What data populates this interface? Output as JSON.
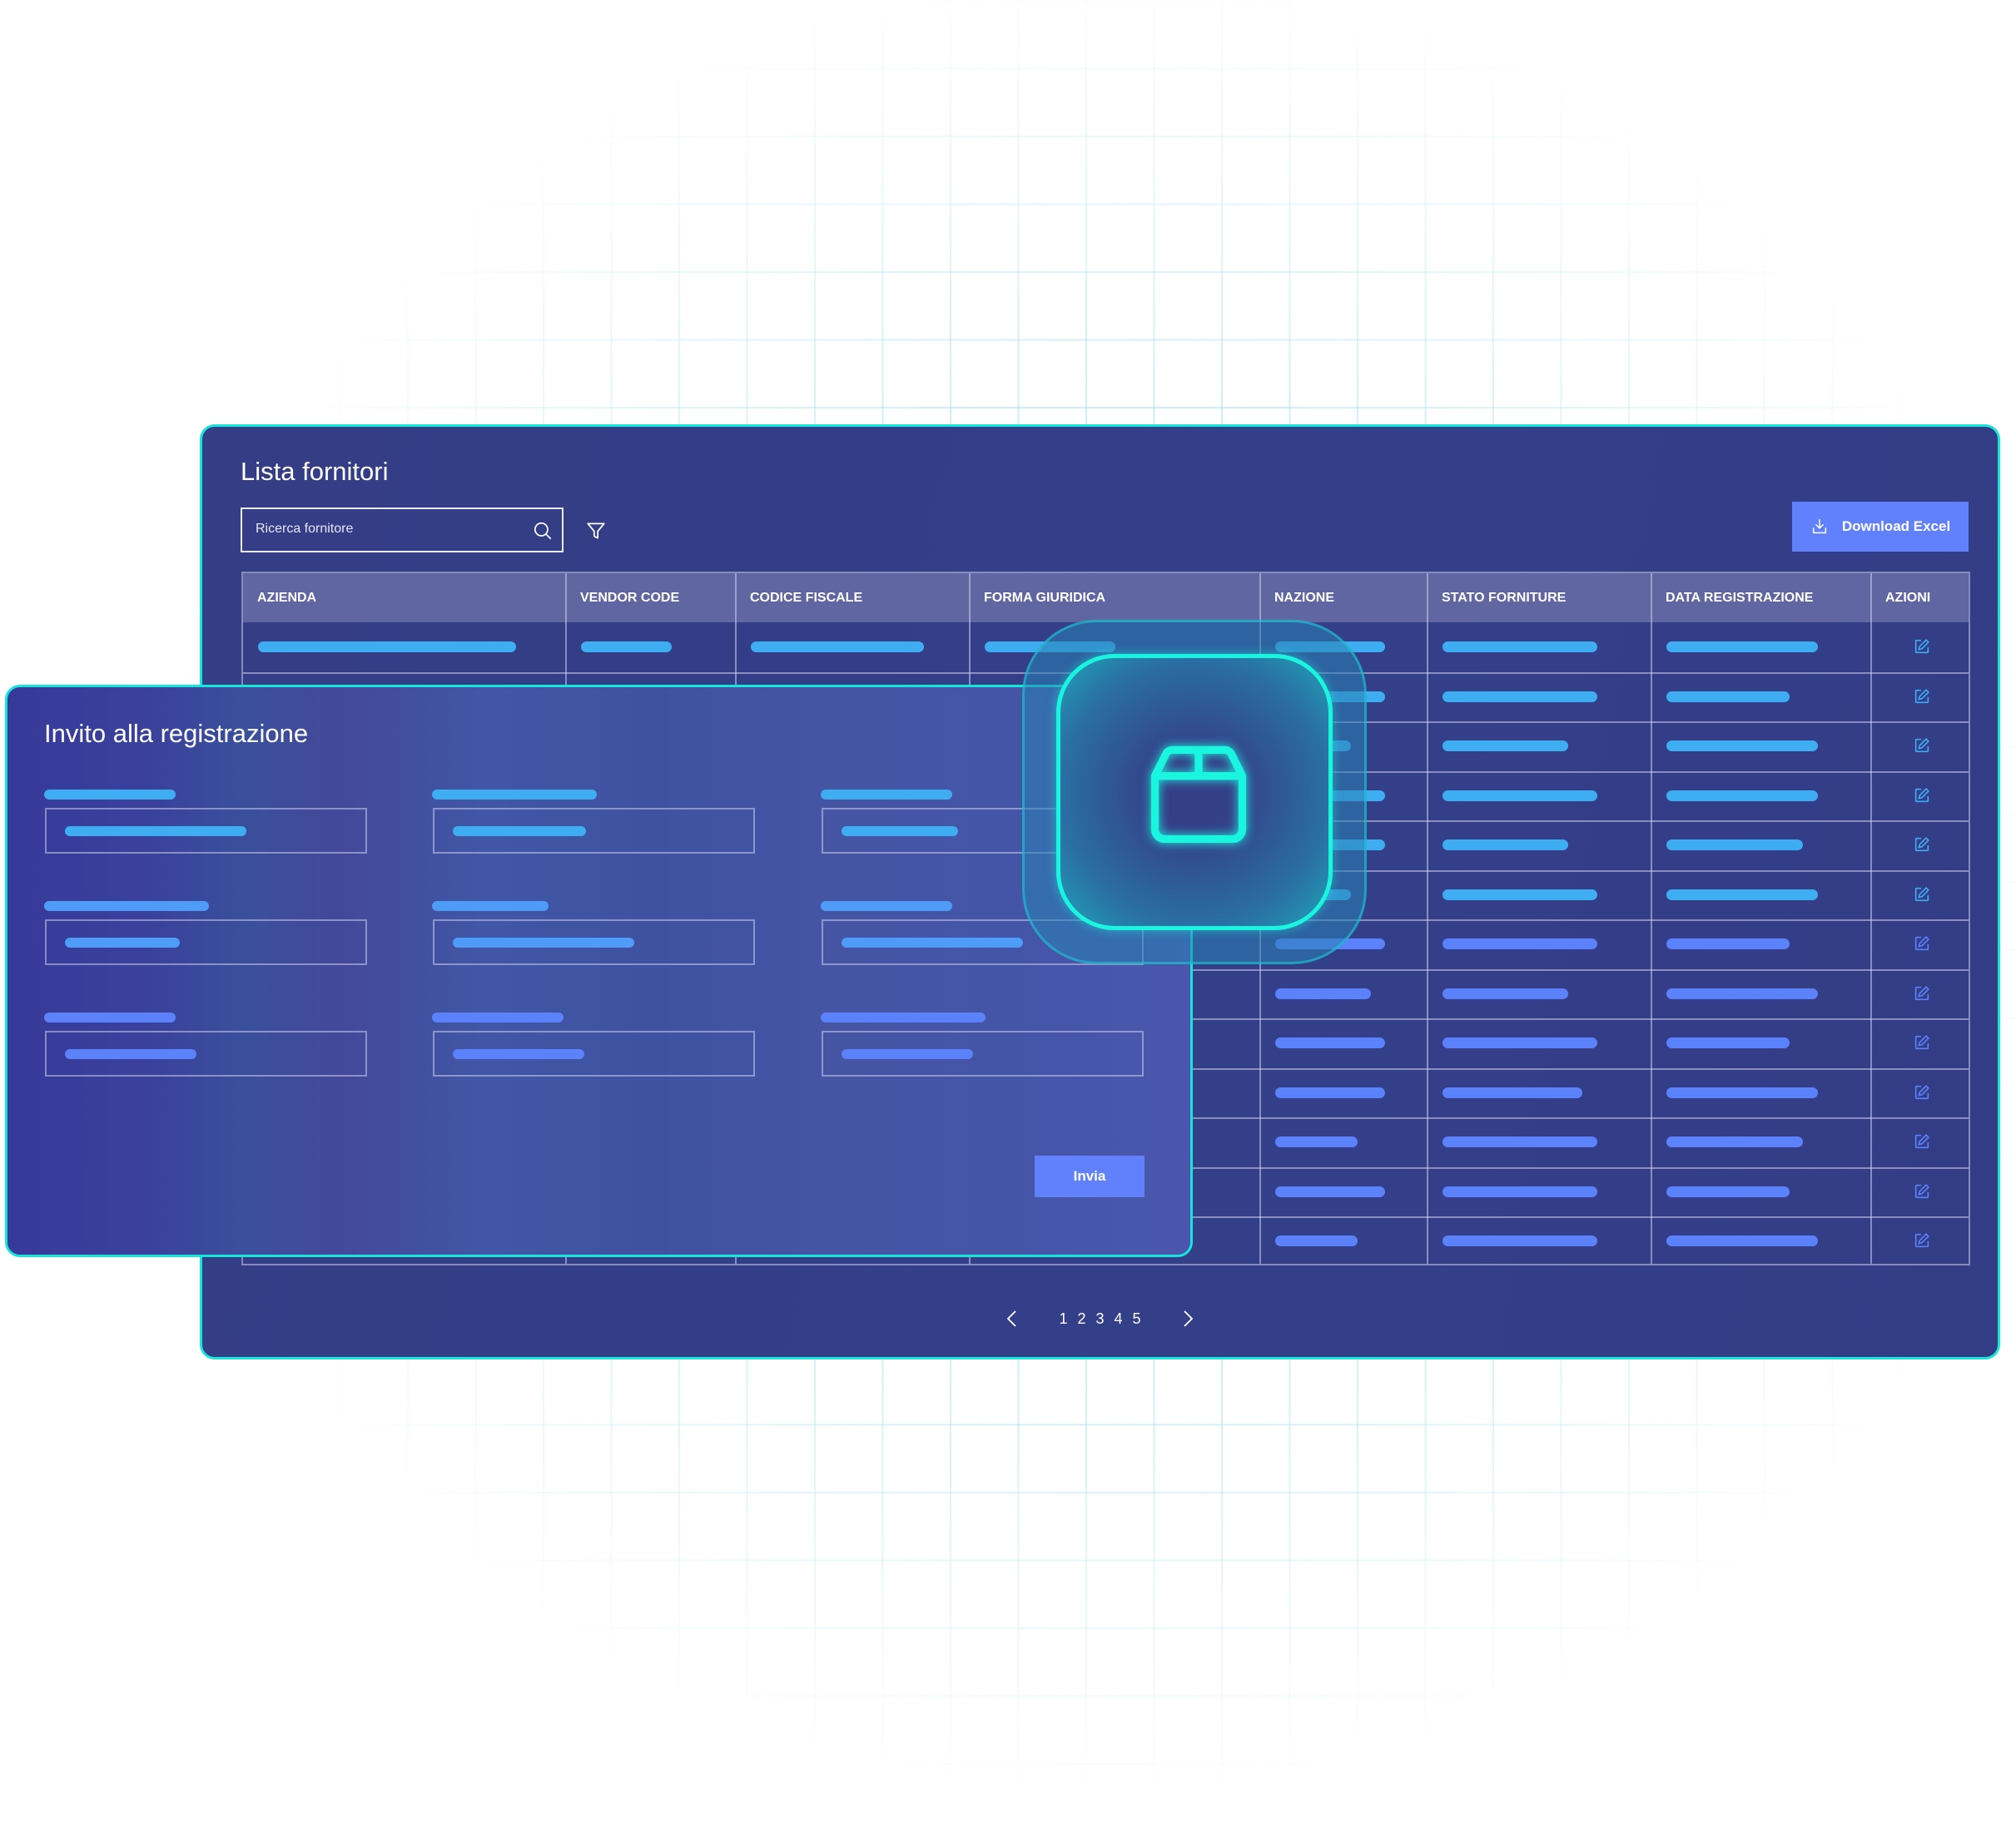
{
  "supplier_list": {
    "title": "Lista fornitori",
    "search_placeholder": "Ricerca fornitore",
    "search_icon": "search-icon",
    "filter_icon": "filter-icon",
    "download_button": {
      "label": "Download Excel",
      "icon": "download-icon"
    },
    "columns": [
      "AZIENDA",
      "VENDOR CODE",
      "CODICE FISCALE",
      "FORMA GIURIDICA",
      "NAZIONE",
      "STATO FORNITURE",
      "DATA REGISTRAZIONE",
      "AZIONI"
    ],
    "row_count": 13,
    "row_action_icon": "edit-icon",
    "pagination": {
      "prev_icon": "chevron-left-icon",
      "pages": [
        "1",
        "2",
        "3",
        "4",
        "5"
      ],
      "next_icon": "chevron-right-icon"
    }
  },
  "invite_modal": {
    "title": "Invito alla registrazione",
    "field_count": 9,
    "submit_label": "Invia"
  },
  "feature_icon": "package-icon",
  "colors": {
    "panel_bg": "#343d86",
    "accent_border": "#16e6d8",
    "button": "#6180fb",
    "header_bg": "#5f66a2",
    "placeholder_bar": "#3eadf2",
    "placeholder_bar_alt": "#5b82fb"
  }
}
